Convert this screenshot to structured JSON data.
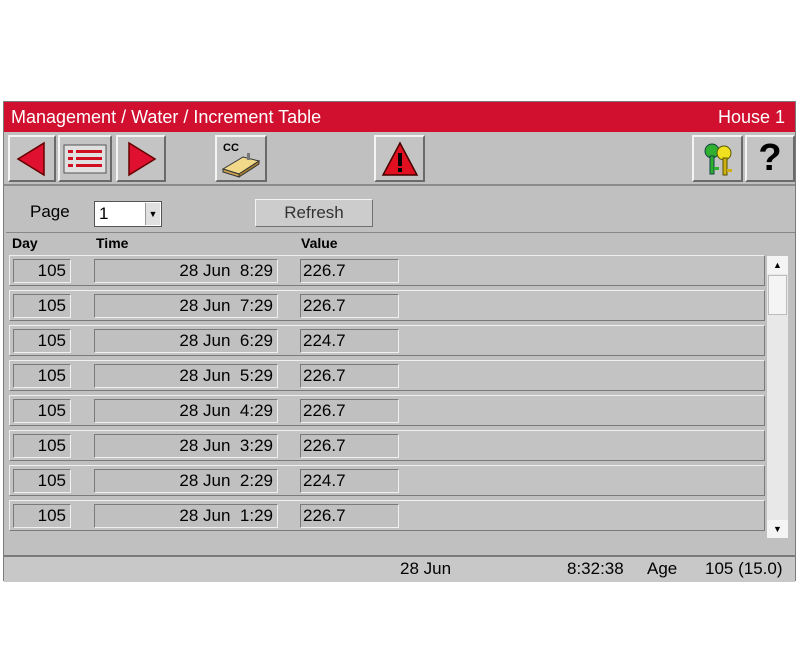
{
  "titlebar": {
    "title": "Management / Water / Increment Table",
    "house": "House 1"
  },
  "toolbar": {
    "buttons": [
      "back-arrow-icon",
      "list-icon",
      "forward-arrow-icon",
      "cc-house-icon",
      "alarm-warning-icon",
      "keys-icon",
      "help-icon"
    ],
    "cc_label": "CC",
    "help_glyph": "?"
  },
  "controls": {
    "page_label": "Page",
    "page_value": "1",
    "refresh_label": "Refresh"
  },
  "table": {
    "columns": [
      "Day",
      "Time",
      "Value"
    ],
    "rows": [
      {
        "day": "105",
        "time": "28 Jun  8:29",
        "value": "226.7"
      },
      {
        "day": "105",
        "time": "28 Jun  7:29",
        "value": "226.7"
      },
      {
        "day": "105",
        "time": "28 Jun  6:29",
        "value": "224.7"
      },
      {
        "day": "105",
        "time": "28 Jun  5:29",
        "value": "226.7"
      },
      {
        "day": "105",
        "time": "28 Jun  4:29",
        "value": "226.7"
      },
      {
        "day": "105",
        "time": "28 Jun  3:29",
        "value": "226.7"
      },
      {
        "day": "105",
        "time": "28 Jun  2:29",
        "value": "224.7"
      },
      {
        "day": "105",
        "time": "28 Jun  1:29",
        "value": "226.7"
      }
    ]
  },
  "status": {
    "date": "28 Jun",
    "time": "8:32:38",
    "age_label": "Age",
    "age_value": "105 (15.0)"
  },
  "colors": {
    "title_bar": "#d0102e",
    "panel": "#c0c0c0",
    "alarm": "#e01020",
    "arrow": "#e01030"
  }
}
